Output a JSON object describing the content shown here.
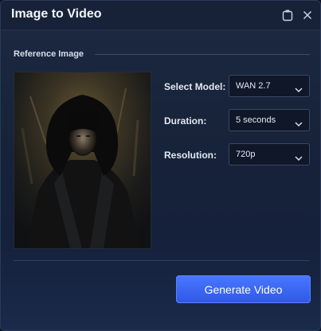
{
  "window": {
    "title": "Image to Video",
    "icons": [
      "clipboard-icon",
      "close-icon"
    ]
  },
  "reference": {
    "section_label": "Reference Image",
    "image_icon": "hooded-figure-artwork"
  },
  "settings": {
    "model_label": "Select Model:",
    "model_value": "WAN 2.7",
    "duration_label": "Duration:",
    "duration_value": "5 seconds",
    "resolution_label": "Resolution:",
    "resolution_value": "720p"
  },
  "actions": {
    "generate_label": "Generate Video"
  },
  "colors": {
    "accent": "#3f6cff",
    "panel": "#172238",
    "select_bg": "#0f1728"
  }
}
